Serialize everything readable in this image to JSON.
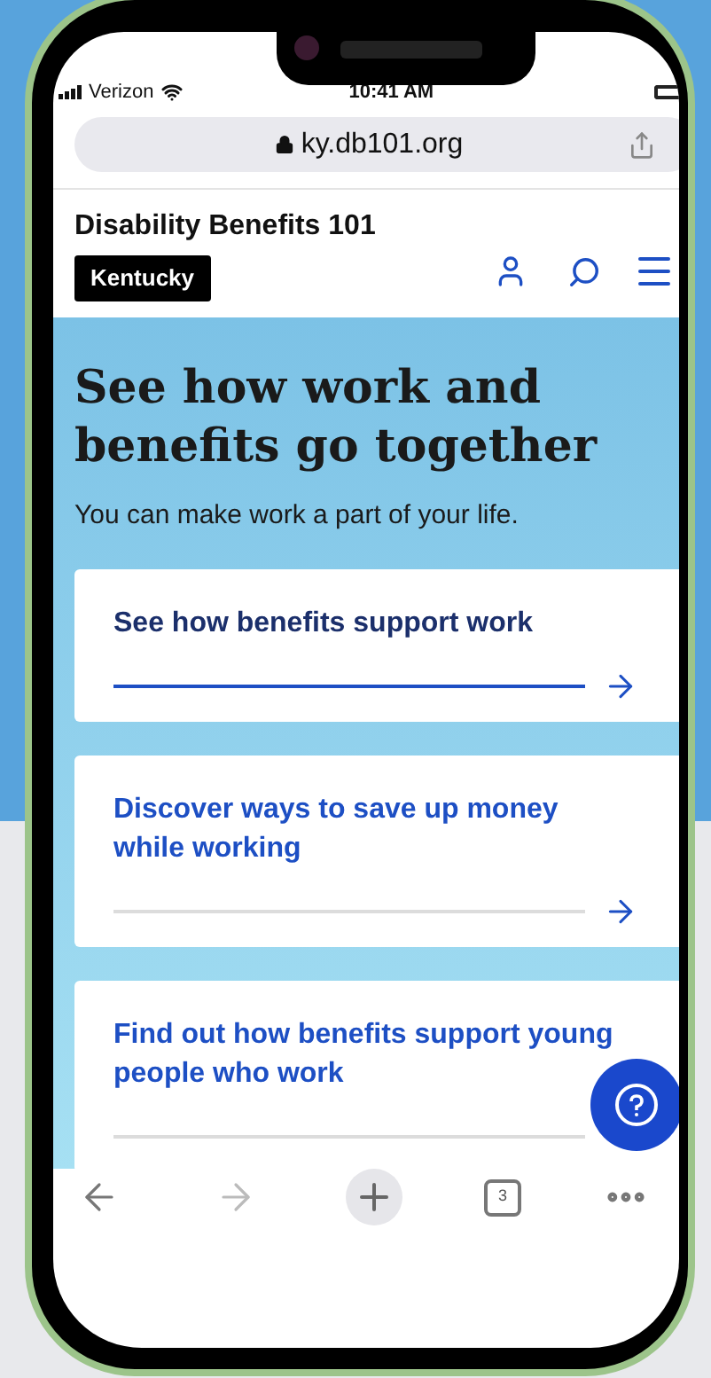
{
  "status_bar": {
    "carrier": "Verizon",
    "time": "10:41 AM"
  },
  "address_bar": {
    "url": "ky.db101.org"
  },
  "site_header": {
    "title": "Disability Benefits 101",
    "state_badge": "Kentucky"
  },
  "hero": {
    "heading": "See how work and benefits go together",
    "subtitle": "You can make work a part of your life."
  },
  "cards": [
    {
      "title": "See how benefits support work",
      "selected": true,
      "arrow": true
    },
    {
      "title": "Discover ways to save up money while working",
      "selected": false,
      "arrow": true
    },
    {
      "title": "Find out how benefits support young people who work",
      "selected": false,
      "arrow": false
    }
  ],
  "browser_toolbar": {
    "tab_count": "3"
  }
}
